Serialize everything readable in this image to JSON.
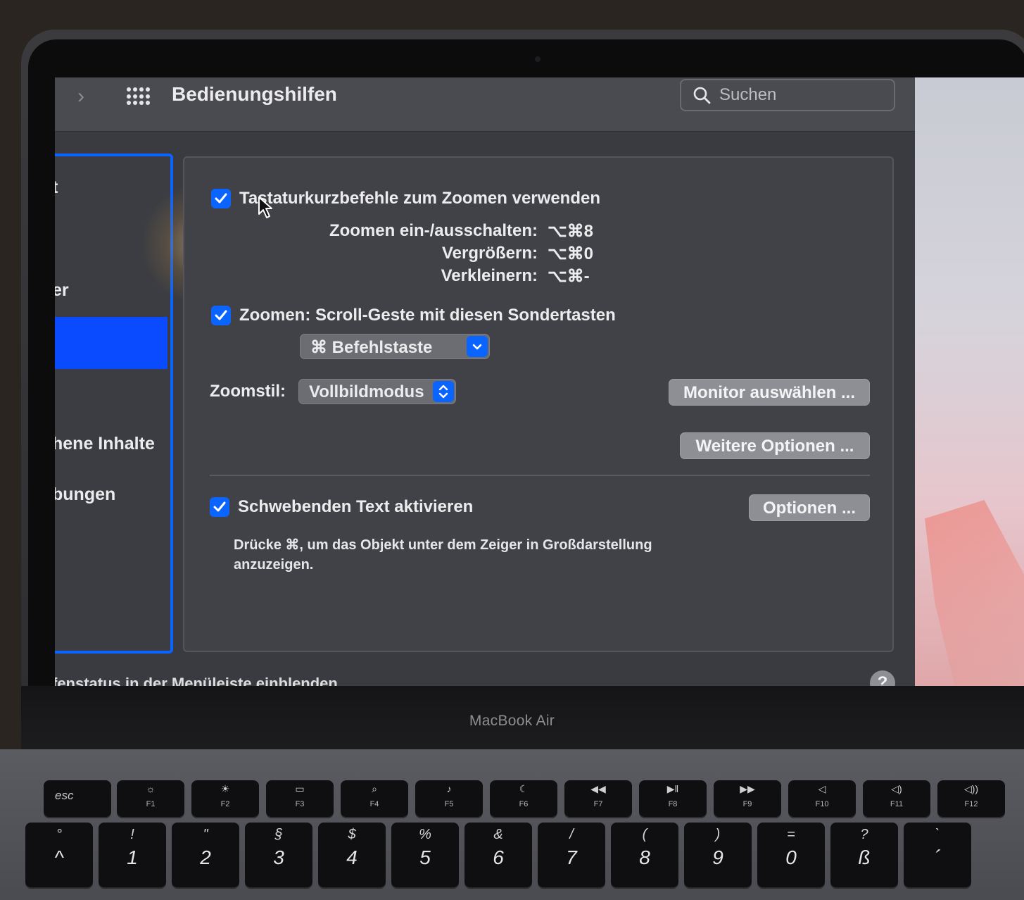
{
  "window": {
    "title": "Bedienungshilfen",
    "search_placeholder": "Suchen"
  },
  "sidebar": {
    "items": [
      {
        "label": "t",
        "selected": false
      },
      {
        "label": "er",
        "selected": false
      },
      {
        "label": "",
        "selected": true
      },
      {
        "label": "hene Inhalte",
        "selected": false
      },
      {
        "label": "bungen",
        "selected": false
      }
    ]
  },
  "zoom": {
    "keyboard_shortcuts": {
      "checked": true,
      "label": "Tastaturkurzbefehle zum Zoomen verwenden",
      "shortcuts": [
        {
          "label": "Zoomen ein-/ausschalten:",
          "keys": "⌥⌘8"
        },
        {
          "label": "Vergrößern:",
          "keys": "⌥⌘0"
        },
        {
          "label": "Verkleinern:",
          "keys": "⌥⌘-"
        }
      ]
    },
    "scroll_gesture": {
      "checked": true,
      "label": "Zoomen: Scroll-Geste mit diesen Sondertasten",
      "modifier_value": "⌘ Befehlstaste"
    },
    "style": {
      "label": "Zoomstil:",
      "value": "Vollbildmodus"
    },
    "select_monitor_button": "Monitor auswählen ...",
    "more_options_button": "Weitere Optionen ..."
  },
  "hover_text": {
    "checked": true,
    "label": "Schwebenden Text aktivieren",
    "options_button": "Optionen ...",
    "description": "Drücke ⌘, um das Objekt unter dem Zeiger in Großdarstellung anzuzeigen."
  },
  "footer": {
    "status_text": "fenstatus in der Menüleiste einblenden",
    "help_label": "?"
  },
  "device": {
    "brand_label": "MacBook Air"
  },
  "colors": {
    "accent": "#0a64ff",
    "window_bg": "#414247",
    "sidebar_selected": "#0a4bff"
  },
  "keyboard": {
    "esc_label": "esc",
    "function_keys": [
      {
        "label": "F1",
        "icon": "brightness-down-icon",
        "glyph": "☼"
      },
      {
        "label": "F2",
        "icon": "brightness-up-icon",
        "glyph": "☀"
      },
      {
        "label": "F3",
        "icon": "mission-control-icon",
        "glyph": "▭"
      },
      {
        "label": "F4",
        "icon": "spotlight-search-icon",
        "glyph": "⌕"
      },
      {
        "label": "F5",
        "icon": "dictation-mic-icon",
        "glyph": "♪"
      },
      {
        "label": "F6",
        "icon": "do-not-disturb-moon-icon",
        "glyph": "☾"
      },
      {
        "label": "F7",
        "icon": "rewind-icon",
        "glyph": "◀◀"
      },
      {
        "label": "F8",
        "icon": "play-pause-icon",
        "glyph": "▶‖"
      },
      {
        "label": "F9",
        "icon": "fast-forward-icon",
        "glyph": "▶▶"
      },
      {
        "label": "F10",
        "icon": "mute-icon",
        "glyph": "◁"
      },
      {
        "label": "F11",
        "icon": "volume-down-icon",
        "glyph": "◁)"
      },
      {
        "label": "F12",
        "icon": "volume-up-icon",
        "glyph": "◁))"
      }
    ],
    "number_keys": [
      {
        "top": "°",
        "bottom": "^"
      },
      {
        "top": "!",
        "bottom": "1"
      },
      {
        "top": "\"",
        "bottom": "2"
      },
      {
        "top": "§",
        "bottom": "3"
      },
      {
        "top": "$",
        "bottom": "4"
      },
      {
        "top": "%",
        "bottom": "5"
      },
      {
        "top": "&",
        "bottom": "6"
      },
      {
        "top": "/",
        "bottom": "7"
      },
      {
        "top": "(",
        "bottom": "8"
      },
      {
        "top": ")",
        "bottom": "9"
      },
      {
        "top": "=",
        "bottom": "0"
      },
      {
        "top": "?",
        "bottom": "ß"
      },
      {
        "top": "`",
        "bottom": "´"
      }
    ]
  }
}
